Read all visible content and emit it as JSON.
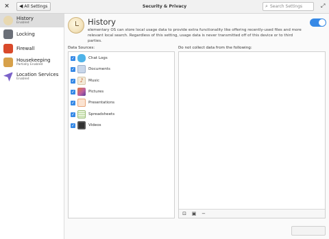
{
  "header": {
    "close_glyph": "×",
    "back_label": "All Settings",
    "title": "Security & Privacy",
    "search_placeholder": "Search Settings",
    "expand_glyph": "⤢"
  },
  "sidebar": {
    "items": [
      {
        "label": "History",
        "sub": "Enabled",
        "icon": "history-clock-icon",
        "active": true,
        "color": "#e8d8b0"
      },
      {
        "label": "Locking",
        "sub": "",
        "icon": "lock-icon",
        "active": false,
        "color": "#6a6f78"
      },
      {
        "label": "Firewall",
        "sub": "",
        "icon": "firewall-icon",
        "active": false,
        "color": "#d94a2b"
      },
      {
        "label": "Housekeeping",
        "sub": "Partially Enabled",
        "icon": "broom-icon",
        "active": false,
        "color": "#d7a14a"
      },
      {
        "label": "Location Services",
        "sub": "Enabled",
        "icon": "location-icon",
        "active": false,
        "color": "#7b62c9"
      }
    ]
  },
  "main": {
    "title": "History",
    "description": "elementary OS can store local usage data to provide extra functionality like offering recently-used files and more relevant local search. Regardless of this setting, usage data is never transmitted off of this device or to third parties.",
    "toggle_on": true,
    "left_label": "Data Sources:",
    "right_label": "Do not collect data from the following:",
    "sources": [
      {
        "label": "Chat Logs",
        "checked": true,
        "icon": "chat-logs-icon",
        "color": "#4fb3e8"
      },
      {
        "label": "Documents",
        "checked": true,
        "icon": "documents-icon",
        "color": "#c9d7ea"
      },
      {
        "label": "Music",
        "checked": true,
        "icon": "music-icon",
        "color": "#f3ead8"
      },
      {
        "label": "Pictures",
        "checked": true,
        "icon": "pictures-icon",
        "color": "#c05fa0"
      },
      {
        "label": "Presentations",
        "checked": true,
        "icon": "presentations-icon",
        "color": "#f0b38a"
      },
      {
        "label": "Spreadsheets",
        "checked": true,
        "icon": "spreadsheets-icon",
        "color": "#b8d89a"
      },
      {
        "label": "Videos",
        "checked": true,
        "icon": "videos-icon",
        "color": "#333333"
      }
    ],
    "toolbar": {
      "add_file_glyph": "⊡",
      "add_folder_glyph": "▣",
      "remove_glyph": "−"
    }
  },
  "colors": {
    "accent": "#3689e6"
  }
}
